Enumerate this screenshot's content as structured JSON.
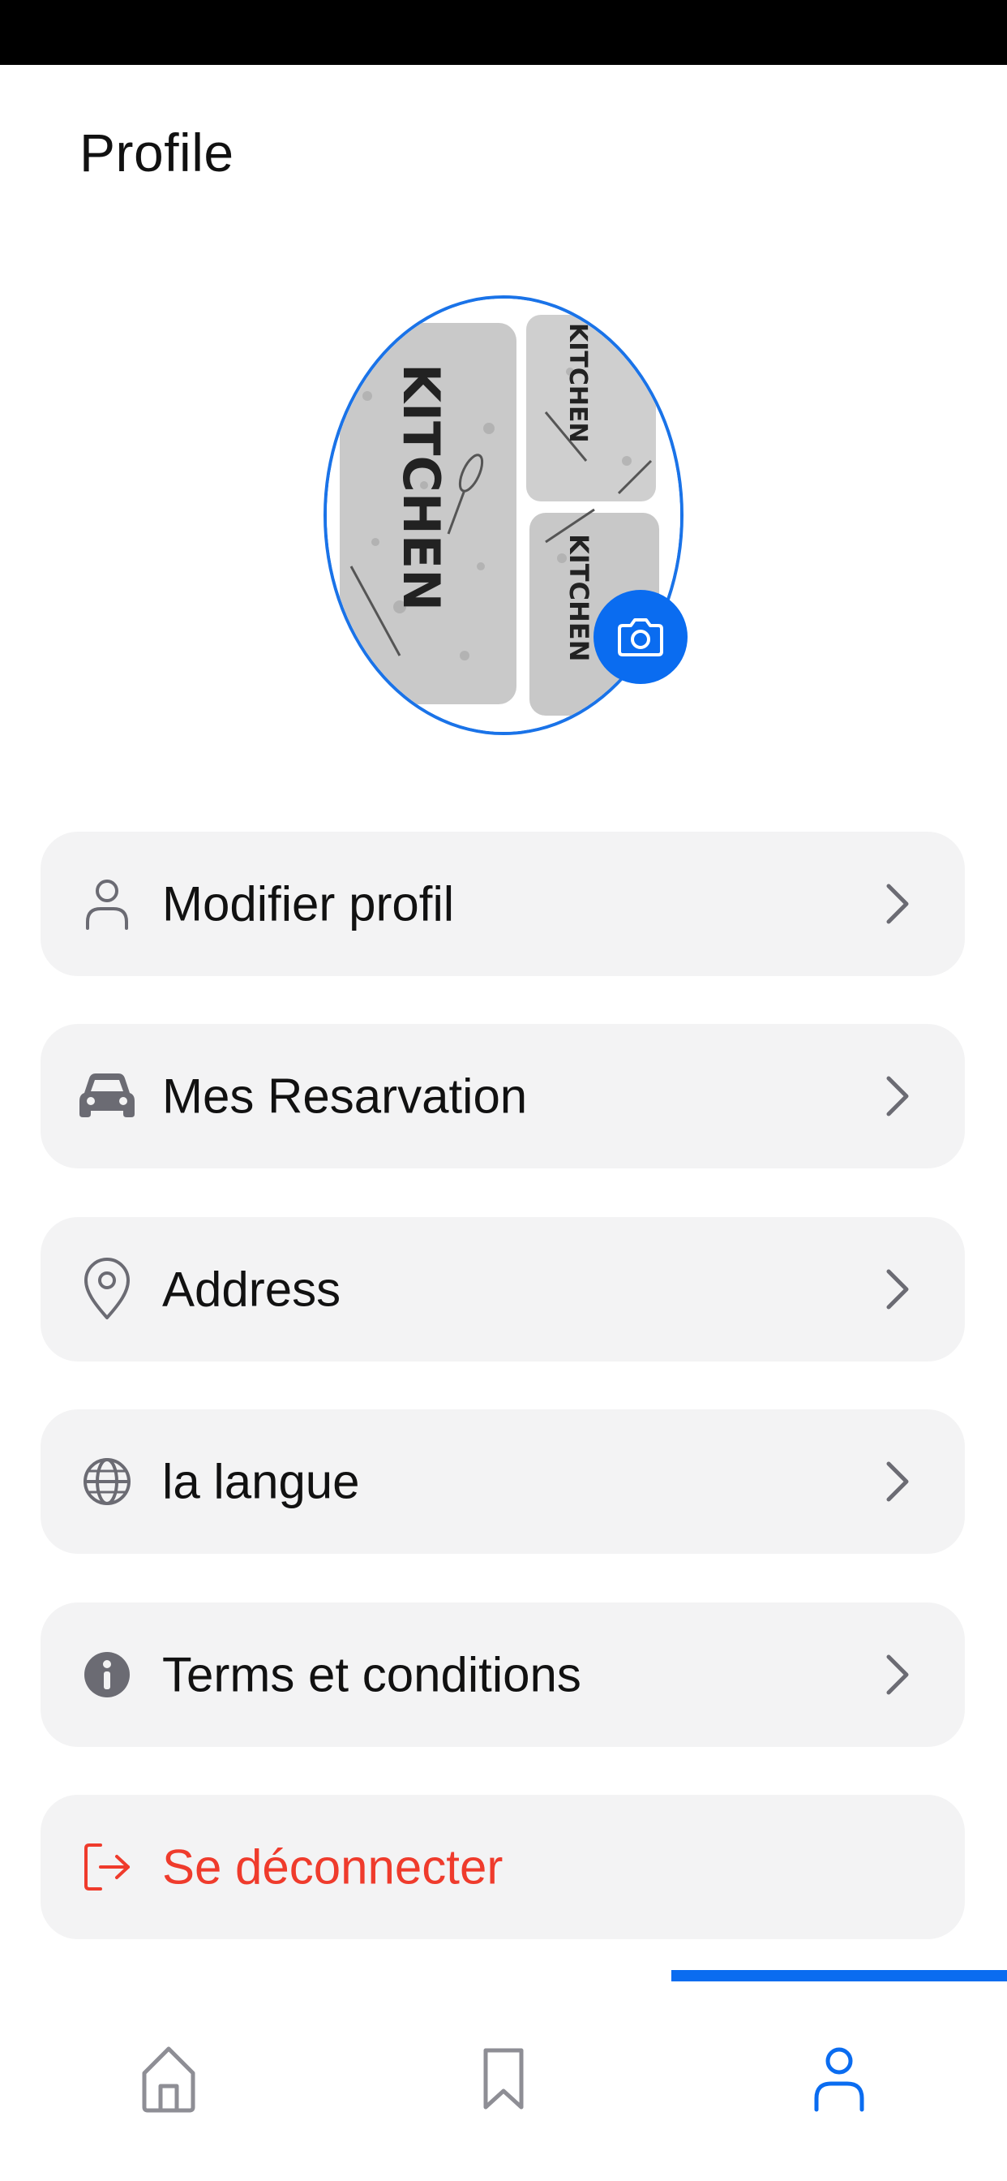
{
  "header": {
    "title": "Profile"
  },
  "profile": {
    "avatar_icon": "kitchen-mat-photo",
    "camera_icon": "camera-icon",
    "avatar_text": "KITCHEN"
  },
  "menu": [
    {
      "label": "Modifier profil",
      "icon": "user-icon"
    },
    {
      "label": "Mes Resarvation",
      "icon": "car-icon"
    },
    {
      "label": "Address",
      "icon": "location-pin-icon"
    },
    {
      "label": "la langue",
      "icon": "globe-icon"
    },
    {
      "label": "Terms et conditions",
      "icon": "info-icon"
    },
    {
      "label": "Se déconnecter",
      "icon": "logout-icon"
    }
  ],
  "tabbar": {
    "items": [
      {
        "name": "home",
        "icon": "home-icon",
        "active": false
      },
      {
        "name": "bookmarks",
        "icon": "bookmark-icon",
        "active": false
      },
      {
        "name": "profile",
        "icon": "user-icon",
        "active": true
      }
    ]
  },
  "colors": {
    "accent": "#0a6cf0",
    "logout": "#ef3b2c",
    "card_bg": "#f3f3f4",
    "icon_gray": "#6b6b73"
  }
}
